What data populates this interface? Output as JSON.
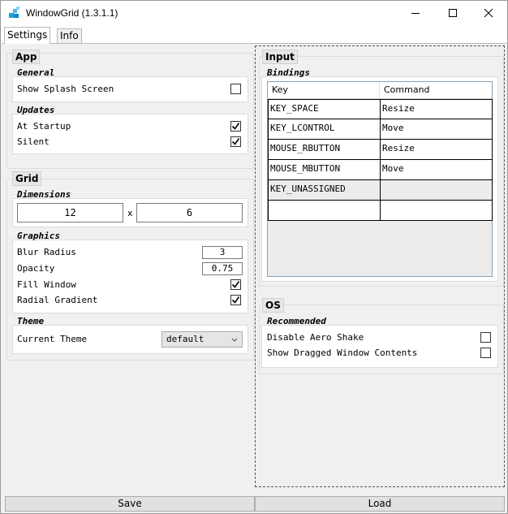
{
  "window": {
    "title": "WindowGrid (1.3.1.1)"
  },
  "tabs": [
    {
      "label": "Settings"
    },
    {
      "label": "Info"
    }
  ],
  "app": {
    "title": "App",
    "general": {
      "title": "General",
      "show_splash_label": "Show Splash Screen",
      "show_splash_checked": false
    },
    "updates": {
      "title": "Updates",
      "at_startup_label": "At Startup",
      "at_startup_checked": true,
      "silent_label": "Silent",
      "silent_checked": true
    }
  },
  "grid": {
    "title": "Grid",
    "dimensions": {
      "title": "Dimensions",
      "columns": "12",
      "separator": "x",
      "rows": "6"
    },
    "graphics": {
      "title": "Graphics",
      "blur_radius_label": "Blur Radius",
      "blur_radius_value": "3",
      "opacity_label": "Opacity",
      "opacity_value": "0.75",
      "fill_window_label": "Fill Window",
      "fill_window_checked": true,
      "radial_gradient_label": "Radial Gradient",
      "radial_gradient_checked": true
    },
    "theme": {
      "title": "Theme",
      "current_theme_label": "Current Theme",
      "current_theme_value": "default"
    }
  },
  "input": {
    "title": "Input",
    "bindings": {
      "title": "Bindings",
      "columns": [
        "Key",
        "Command"
      ],
      "rows": [
        {
          "key": "KEY_SPACE",
          "command": "Resize"
        },
        {
          "key": "KEY_LCONTROL",
          "command": "Move"
        },
        {
          "key": "MOUSE_RBUTTON",
          "command": "Resize"
        },
        {
          "key": "MOUSE_MBUTTON",
          "command": "Move"
        },
        {
          "key": "KEY_UNASSIGNED",
          "command": ""
        },
        {
          "key": "",
          "command": ""
        }
      ]
    }
  },
  "os": {
    "title": "OS",
    "recommended": {
      "title": "Recommended",
      "disable_aero_label": "Disable Aero Shake",
      "disable_aero_checked": false,
      "show_dragged_label": "Show Dragged Window Contents",
      "show_dragged_checked": false
    }
  },
  "footer": {
    "save_label": "Save",
    "load_label": "Load"
  },
  "colors": {
    "title_bar": "#ffffff",
    "panel": "#f0f0f0",
    "accent": "#1ba1e2"
  }
}
